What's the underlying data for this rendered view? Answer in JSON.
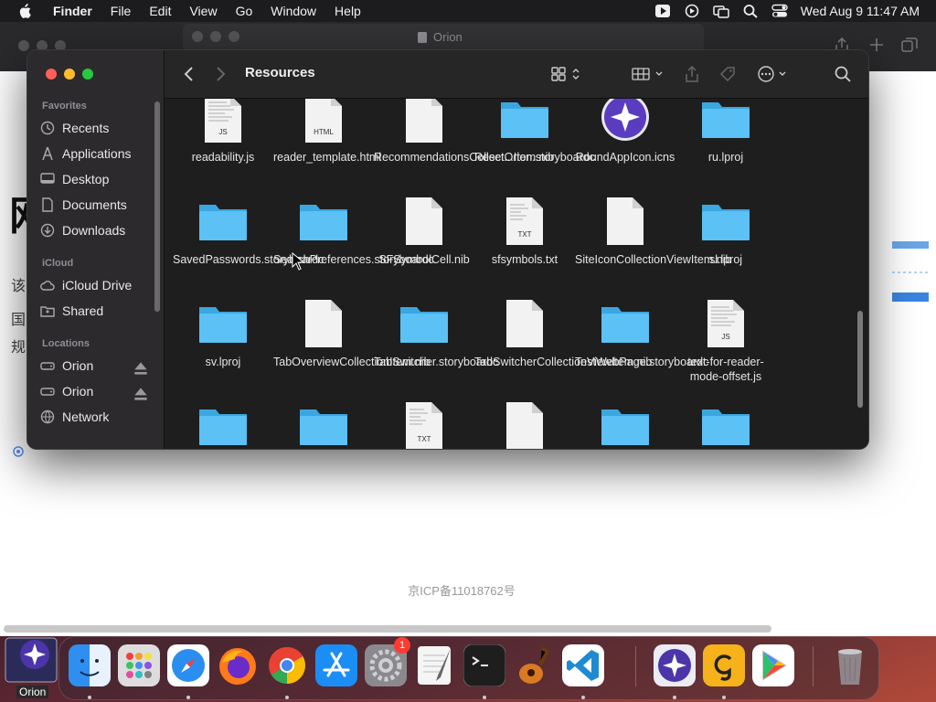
{
  "menubar": {
    "app": "Finder",
    "items": [
      "File",
      "Edit",
      "View",
      "Go",
      "Window",
      "Help"
    ],
    "datetime": "Wed Aug 9  11:47 AM"
  },
  "orion_window": {
    "tab_title": "Orion",
    "left_char": "网",
    "side_text": [
      "该",
      "国",
      "规"
    ],
    "footer": "京ICP备11018762号"
  },
  "finder": {
    "title": "Resources",
    "sidebar": {
      "favorites_label": "Favorites",
      "favorites": [
        "Recents",
        "Applications",
        "Desktop",
        "Documents",
        "Downloads"
      ],
      "icloud_label": "iCloud",
      "icloud": [
        "iCloud Drive",
        "Shared"
      ],
      "locations_label": "Locations",
      "locations": [
        "Orion",
        "Orion",
        "Network"
      ]
    },
    "files": [
      {
        "name": "readability.js",
        "kind": "js"
      },
      {
        "name": "reader_template.html",
        "kind": "html"
      },
      {
        "name": "RecommendationsCollect...Item.nib",
        "kind": "doc"
      },
      {
        "name": "ResetOrion.storyboardc",
        "kind": "folder"
      },
      {
        "name": "RoundAppIcon.icns",
        "kind": "orion"
      },
      {
        "name": "ru.lproj",
        "kind": "folder"
      },
      {
        "name": "SavedPasswords.storyboardc",
        "kind": "folder"
      },
      {
        "name": "SearchPreferences.storyboardc",
        "kind": "folder"
      },
      {
        "name": "SFSymbolCell.nib",
        "kind": "doc"
      },
      {
        "name": "sfsymbols.txt",
        "kind": "txt"
      },
      {
        "name": "SiteIconCollectionViewItem.nib",
        "kind": "doc"
      },
      {
        "name": "sl.lproj",
        "kind": "folder"
      },
      {
        "name": "sv.lproj",
        "kind": "folder"
      },
      {
        "name": "TabOverviewCollectionItem.nib",
        "kind": "doc"
      },
      {
        "name": "TabSwitcher.storyboardc",
        "kind": "folder"
      },
      {
        "name": "TabSwitcherCollectionViewItem.nib",
        "kind": "doc"
      },
      {
        "name": "TestWebPage.storyboardc",
        "kind": "folder"
      },
      {
        "name": "text-for-reader-mode-offset.js",
        "kind": "js"
      },
      {
        "name": "",
        "kind": "folder"
      },
      {
        "name": "",
        "kind": "folder"
      },
      {
        "name": "",
        "kind": "txt"
      },
      {
        "name": "",
        "kind": "doc"
      },
      {
        "name": "",
        "kind": "folder"
      },
      {
        "name": "",
        "kind": "folder"
      }
    ],
    "file_labels": {
      "js": "JS",
      "html": "HTML",
      "txt": "TXT"
    }
  },
  "dock": {
    "orion_label": "Orion",
    "settings_badge": "1",
    "apps": [
      "finder-icon",
      "launchpad-icon",
      "safari-icon",
      "firefox-icon",
      "chrome-icon",
      "app-store-icon",
      "system-settings-icon",
      "textedit-icon",
      "terminal-icon",
      "garageband-icon",
      "vscode-icon",
      "orion-icon",
      "grammarly-icon",
      "google-play-icon",
      "trash-icon"
    ]
  }
}
